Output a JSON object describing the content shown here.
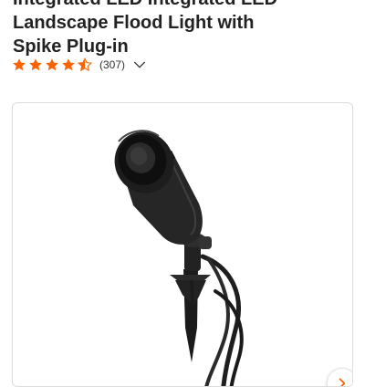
{
  "product": {
    "title_lines": [
      "Integrated LED Integrated LED",
      "Landscape Flood Light with",
      "Spike Plug-in"
    ]
  },
  "rating": {
    "stars": 4.5,
    "count": "(307)",
    "star_color": "#f96302"
  },
  "gallery": {
    "image_icon": "landscape-flood-light-image",
    "next_icon": "chevron-right-icon",
    "next_color": "#f96302"
  }
}
